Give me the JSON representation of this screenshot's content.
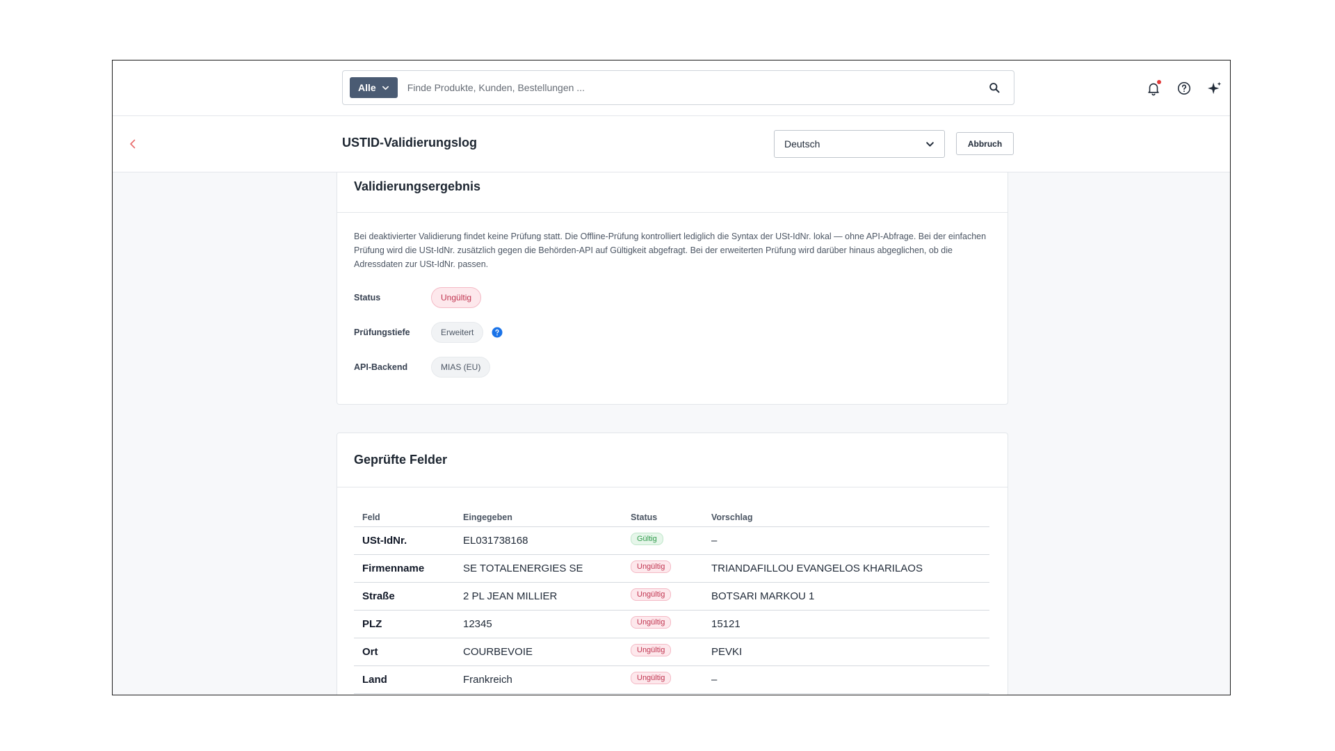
{
  "search": {
    "scope_label": "Alle",
    "placeholder": "Finde Produkte, Kunden, Bestellungen ..."
  },
  "topbar_icons": [
    "bell-icon",
    "help-icon",
    "sparkle-icon"
  ],
  "header": {
    "title": "USTID-Validierungslog",
    "language": "Deutsch",
    "cancel_label": "Abbruch"
  },
  "result": {
    "title": "Validierungsergebnis",
    "description": "Bei deaktivierter Validierung findet keine Prüfung statt. Die Offline-Prüfung kontrolliert lediglich die Syntax der USt-IdNr. lokal — ohne API-Abfrage. Bei der einfachen Prüfung wird die USt-IdNr. zusätzlich gegen die Behörden-API auf Gültigkeit abgefragt. Bei der erweiterten Prüfung wird darüber hinaus abgeglichen, ob die Adressdaten zur USt-IdNr. passen.",
    "status_label": "Status",
    "status_value": "Ungültig",
    "depth_label": "Prüfungstiefe",
    "depth_value": "Erweitert",
    "backend_label": "API-Backend",
    "backend_value": "MIAS (EU)"
  },
  "fields": {
    "title": "Geprüfte Felder",
    "columns": [
      "Feld",
      "Eingegeben",
      "Status",
      "Vorschlag"
    ],
    "rows": [
      {
        "field": "USt-IdNr.",
        "entered": "EL031738168",
        "status": "Gültig",
        "valid": true,
        "suggestion": "–"
      },
      {
        "field": "Firmenname",
        "entered": "SE TOTALENERGIES SE",
        "status": "Ungültig",
        "valid": false,
        "suggestion": "TRIANDAFILLOU EVANGELOS KHARILAOS"
      },
      {
        "field": "Straße",
        "entered": "2 PL JEAN MILLIER",
        "status": "Ungültig",
        "valid": false,
        "suggestion": "BOTSARI MARKOU 1"
      },
      {
        "field": "PLZ",
        "entered": "12345",
        "status": "Ungültig",
        "valid": false,
        "suggestion": "15121"
      },
      {
        "field": "Ort",
        "entered": "COURBEVOIE",
        "status": "Ungültig",
        "valid": false,
        "suggestion": "PEVKI"
      },
      {
        "field": "Land",
        "entered": "Frankreich",
        "status": "Ungültig",
        "valid": false,
        "suggestion": "–"
      }
    ]
  },
  "colors": {
    "accent": "#4a5b73",
    "danger": "#c0334f",
    "success": "#2f9a4a",
    "back_arrow": "#e86b6b",
    "info": "#1a73e8"
  }
}
